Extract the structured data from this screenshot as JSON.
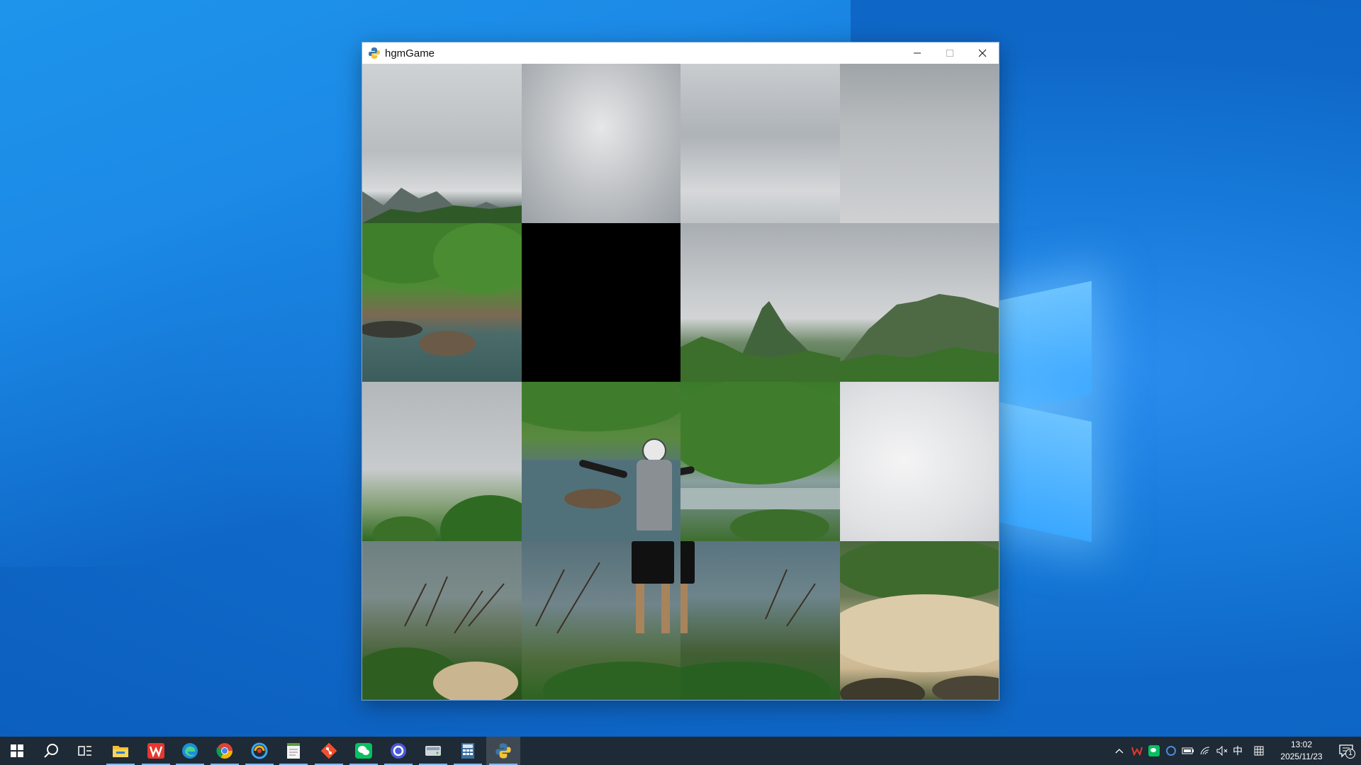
{
  "window": {
    "title": "hgmGame",
    "icon": "python-icon"
  },
  "puzzle": {
    "grid": [
      4,
      4
    ],
    "empty_tile": {
      "row": 1,
      "col": 1
    }
  },
  "taskbar": {
    "apps": [
      {
        "name": "start-button",
        "icon": "windows-icon"
      },
      {
        "name": "search-button",
        "icon": "search-icon"
      },
      {
        "name": "task-view-button",
        "icon": "task-view-icon"
      },
      {
        "name": "file-explorer",
        "icon": "folder-icon",
        "running": true
      },
      {
        "name": "wps-office",
        "icon": "wps-icon",
        "running": true
      },
      {
        "name": "edge-browser",
        "icon": "edge-icon",
        "running": true
      },
      {
        "name": "chrome-browser",
        "icon": "chrome-icon",
        "running": true
      },
      {
        "name": "pycharm-like-app",
        "icon": "app-swirl-icon",
        "running": true
      },
      {
        "name": "notepad-app",
        "icon": "notepad-icon",
        "running": true
      },
      {
        "name": "git-app",
        "icon": "git-icon",
        "running": true
      },
      {
        "name": "wechat-app",
        "icon": "wechat-icon",
        "running": true
      },
      {
        "name": "circle-app",
        "icon": "circle-app-icon",
        "running": true
      },
      {
        "name": "disk-app",
        "icon": "disk-icon",
        "running": true
      },
      {
        "name": "calculator-app",
        "icon": "calculator-icon",
        "running": true
      },
      {
        "name": "python-game-app",
        "icon": "python-icon",
        "running": true,
        "active": true
      }
    ],
    "tray": {
      "ime_label": "中",
      "time": "13:02",
      "date": "2025/11/23",
      "notification_count": "1"
    }
  }
}
